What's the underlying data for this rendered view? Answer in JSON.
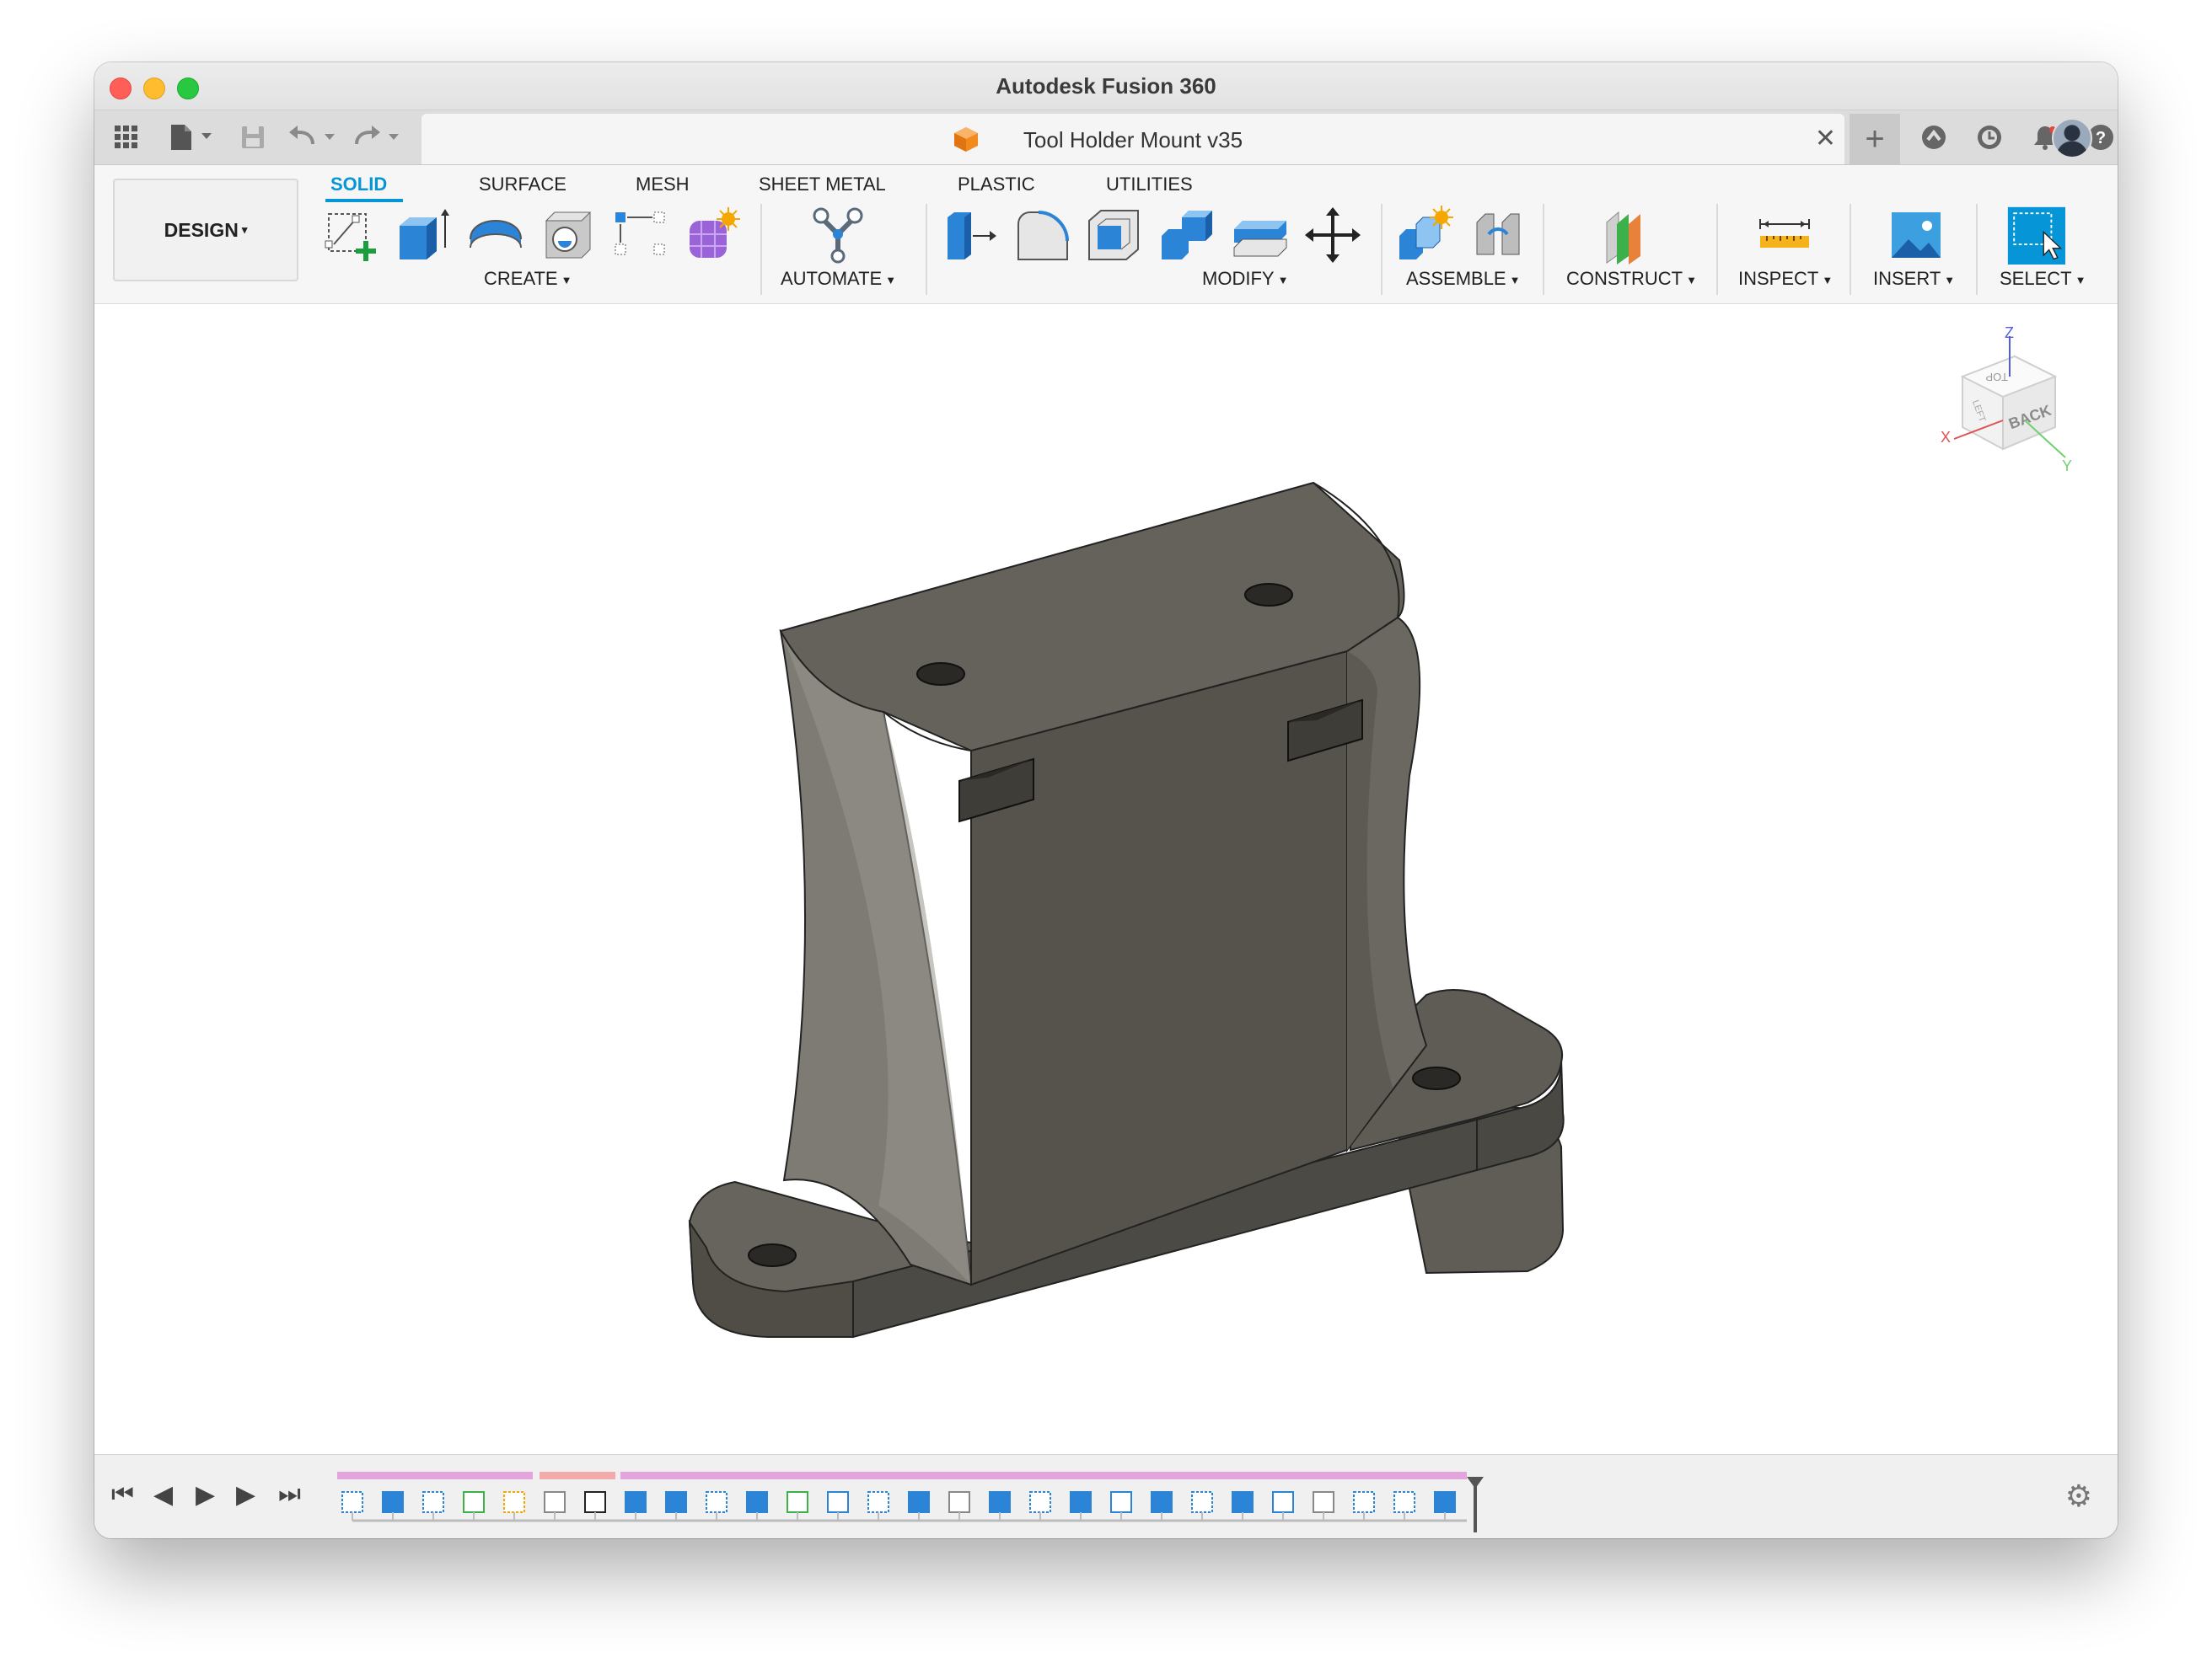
{
  "window": {
    "title": "Autodesk Fusion 360"
  },
  "document": {
    "title": "Tool Holder Mount v35",
    "close_glyph": "✕",
    "new_tab_glyph": "+"
  },
  "workspace": {
    "label": "DESIGN",
    "caret": "▾"
  },
  "tabs": [
    {
      "label": "SOLID",
      "active": true
    },
    {
      "label": "SURFACE",
      "active": false
    },
    {
      "label": "MESH",
      "active": false
    },
    {
      "label": "SHEET METAL",
      "active": false
    },
    {
      "label": "PLASTIC",
      "active": false
    },
    {
      "label": "UTILITIES",
      "active": false
    }
  ],
  "groups": {
    "create": "CREATE",
    "automate": "AUTOMATE",
    "modify": "MODIFY",
    "assemble": "ASSEMBLE",
    "construct": "CONSTRUCT",
    "inspect": "INSPECT",
    "insert": "INSERT",
    "select": "SELECT"
  },
  "viewcube": {
    "top": "TOP",
    "back": "BACK",
    "left": "LEFT",
    "axis_z": "Z",
    "axis_x": "X",
    "axis_y": "Y"
  },
  "colors": {
    "accent": "#0696d7",
    "timeline_group_pink": "#e3a5dc",
    "timeline_group_red": "#f3aaaa",
    "model_face": "#55534c"
  },
  "icons": [
    "apps-grid-icon",
    "file-icon",
    "save-icon",
    "undo-icon",
    "redo-icon",
    "extension-icon",
    "job-status-icon",
    "notifications-icon",
    "help-icon",
    "profile-avatar"
  ]
}
